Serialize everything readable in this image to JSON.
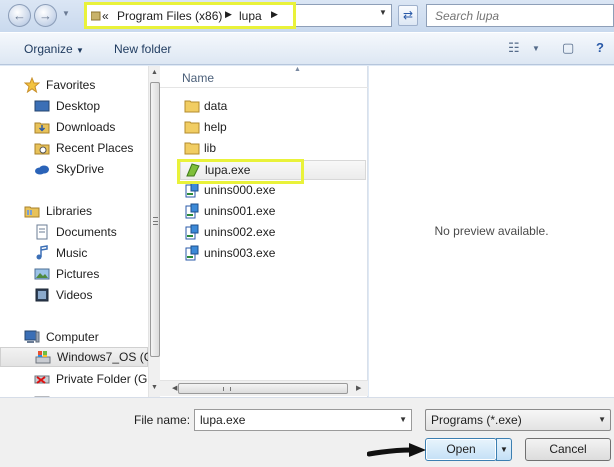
{
  "address_bar": {
    "recent_chevrons": "«",
    "path": [
      "Program Files (x86)",
      "lupa"
    ],
    "search_placeholder": "Search lupa"
  },
  "toolbar": {
    "organize_label": "Organize",
    "new_folder_label": "New folder"
  },
  "nav": {
    "favorites_header": "Favorites",
    "favorites": [
      "Desktop",
      "Downloads",
      "Recent Places",
      "SkyDrive"
    ],
    "libraries_header": "Libraries",
    "libraries": [
      "Documents",
      "Music",
      "Pictures",
      "Videos"
    ],
    "computer_header": "Computer",
    "computer": [
      "Windows7_OS (C",
      "Private Folder (G:"
    ]
  },
  "file_list": {
    "column_name": "Name",
    "folders": [
      "data",
      "help",
      "lib"
    ],
    "files": [
      "lupa.exe",
      "unins000.exe",
      "unins001.exe",
      "unins002.exe",
      "unins003.exe"
    ],
    "selected": "lupa.exe"
  },
  "preview": {
    "message": "No preview available."
  },
  "footer": {
    "file_name_label": "File name:",
    "file_name_value": "lupa.exe",
    "filter_value": "Programs (*.exe)",
    "open_label": "Open",
    "cancel_label": "Cancel"
  },
  "colors": {
    "highlight": "#e9f23a",
    "window_chrome": "#dfe9f5",
    "open_button": "#c4e0f6"
  }
}
